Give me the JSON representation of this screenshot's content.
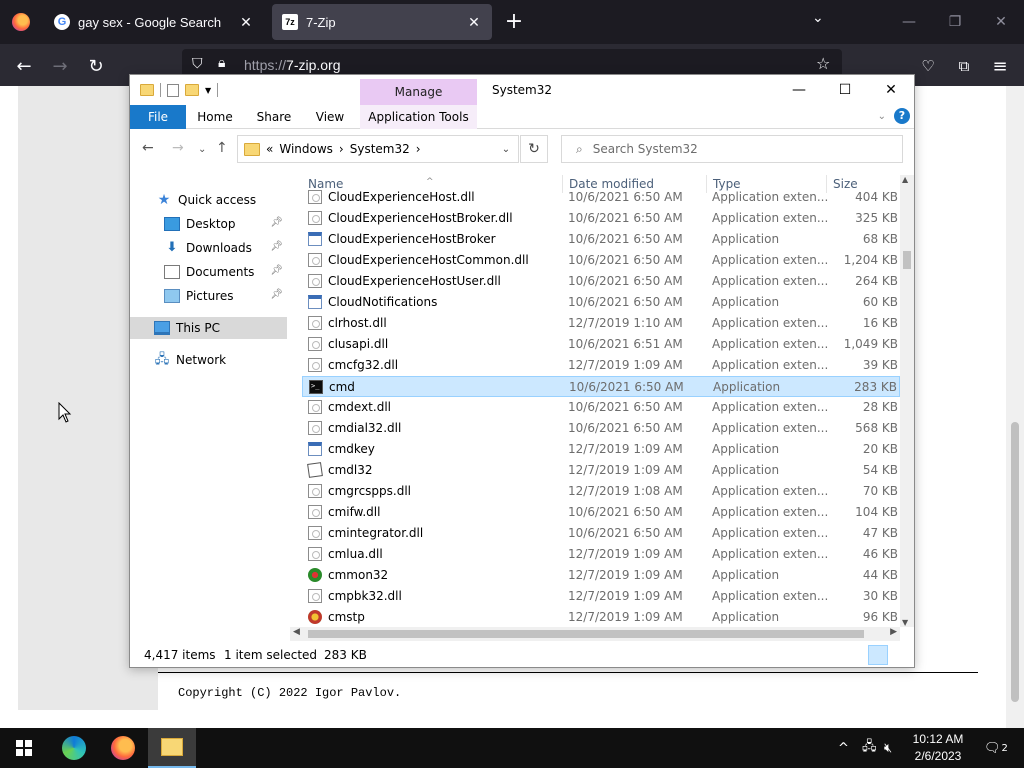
{
  "browser": {
    "tabs": [
      {
        "title": "gay sex - Google Search",
        "favicon": "google-icon"
      },
      {
        "title": "7-Zip",
        "favicon": "7zip-icon"
      }
    ],
    "url_scheme": "https://",
    "url_host": "7-zip.org"
  },
  "page": {
    "copyright": "Copyright (C) 2022 Igor Pavlov."
  },
  "explorer": {
    "window_title": "System32",
    "contextual_tab": "Manage",
    "ribbon_tabs": [
      "File",
      "Home",
      "Share",
      "View",
      "Application Tools"
    ],
    "breadcrumb_prefix": "«",
    "breadcrumb": [
      "Windows",
      "System32"
    ],
    "search_placeholder": "Search System32",
    "nav": [
      {
        "label": "Quick access",
        "icon": "star-icon"
      },
      {
        "label": "Desktop",
        "icon": "desktop-icon",
        "pinned": true
      },
      {
        "label": "Downloads",
        "icon": "downloads-icon",
        "pinned": true
      },
      {
        "label": "Documents",
        "icon": "documents-icon",
        "pinned": true
      },
      {
        "label": "Pictures",
        "icon": "pictures-icon",
        "pinned": true
      },
      {
        "label": "This PC",
        "icon": "pc-icon",
        "selected": true
      },
      {
        "label": "Network",
        "icon": "network-icon"
      }
    ],
    "columns": [
      "Name",
      "Date modified",
      "Type",
      "Size"
    ],
    "files": [
      {
        "name": "CloudExperienceHost.dll",
        "date": "10/6/2021 6:50 AM",
        "type": "Application exten...",
        "size": "404 KB",
        "icon": "dll"
      },
      {
        "name": "CloudExperienceHostBroker.dll",
        "date": "10/6/2021 6:50 AM",
        "type": "Application exten...",
        "size": "325 KB",
        "icon": "dll"
      },
      {
        "name": "CloudExperienceHostBroker",
        "date": "10/6/2021 6:50 AM",
        "type": "Application",
        "size": "68 KB",
        "icon": "app"
      },
      {
        "name": "CloudExperienceHostCommon.dll",
        "date": "10/6/2021 6:50 AM",
        "type": "Application exten...",
        "size": "1,204 KB",
        "icon": "dll"
      },
      {
        "name": "CloudExperienceHostUser.dll",
        "date": "10/6/2021 6:50 AM",
        "type": "Application exten...",
        "size": "264 KB",
        "icon": "dll"
      },
      {
        "name": "CloudNotifications",
        "date": "10/6/2021 6:50 AM",
        "type": "Application",
        "size": "60 KB",
        "icon": "app"
      },
      {
        "name": "clrhost.dll",
        "date": "12/7/2019 1:10 AM",
        "type": "Application exten...",
        "size": "16 KB",
        "icon": "dll"
      },
      {
        "name": "clusapi.dll",
        "date": "10/6/2021 6:51 AM",
        "type": "Application exten...",
        "size": "1,049 KB",
        "icon": "dll"
      },
      {
        "name": "cmcfg32.dll",
        "date": "12/7/2019 1:09 AM",
        "type": "Application exten...",
        "size": "39 KB",
        "icon": "dll"
      },
      {
        "name": "cmd",
        "date": "10/6/2021 6:50 AM",
        "type": "Application",
        "size": "283 KB",
        "icon": "cmd",
        "selected": true
      },
      {
        "name": "cmdext.dll",
        "date": "10/6/2021 6:50 AM",
        "type": "Application exten...",
        "size": "28 KB",
        "icon": "dll"
      },
      {
        "name": "cmdial32.dll",
        "date": "10/6/2021 6:50 AM",
        "type": "Application exten...",
        "size": "568 KB",
        "icon": "dll"
      },
      {
        "name": "cmdkey",
        "date": "12/7/2019 1:09 AM",
        "type": "Application",
        "size": "20 KB",
        "icon": "app"
      },
      {
        "name": "cmdl32",
        "date": "12/7/2019 1:09 AM",
        "type": "Application",
        "size": "54 KB",
        "icon": "cmdl"
      },
      {
        "name": "cmgrcspps.dll",
        "date": "12/7/2019 1:08 AM",
        "type": "Application exten...",
        "size": "70 KB",
        "icon": "dll"
      },
      {
        "name": "cmifw.dll",
        "date": "10/6/2021 6:50 AM",
        "type": "Application exten...",
        "size": "104 KB",
        "icon": "dll"
      },
      {
        "name": "cmintegrator.dll",
        "date": "10/6/2021 6:50 AM",
        "type": "Application exten...",
        "size": "47 KB",
        "icon": "dll"
      },
      {
        "name": "cmlua.dll",
        "date": "12/7/2019 1:09 AM",
        "type": "Application exten...",
        "size": "46 KB",
        "icon": "dll"
      },
      {
        "name": "cmmon32",
        "date": "12/7/2019 1:09 AM",
        "type": "Application",
        "size": "44 KB",
        "icon": "cmmon"
      },
      {
        "name": "cmpbk32.dll",
        "date": "12/7/2019 1:09 AM",
        "type": "Application exten...",
        "size": "30 KB",
        "icon": "dll"
      },
      {
        "name": "cmstp",
        "date": "12/7/2019 1:09 AM",
        "type": "Application",
        "size": "96 KB",
        "icon": "cmstp"
      }
    ],
    "status": {
      "items": "4,417 items",
      "selected": "1 item selected",
      "size": "283 KB"
    }
  },
  "taskbar": {
    "apps": [
      "windows-start-icon",
      "edge-icon",
      "firefox-icon",
      "file-explorer-icon"
    ],
    "time": "10:12 AM",
    "date": "2/6/2023",
    "notifications": "2"
  },
  "colors": {
    "ribbon_file_blue": "#1979ca",
    "manage_tab_purple": "#e9c9f3",
    "selection_blue": "#cce8ff",
    "ff_dark": "#1c1b22"
  }
}
